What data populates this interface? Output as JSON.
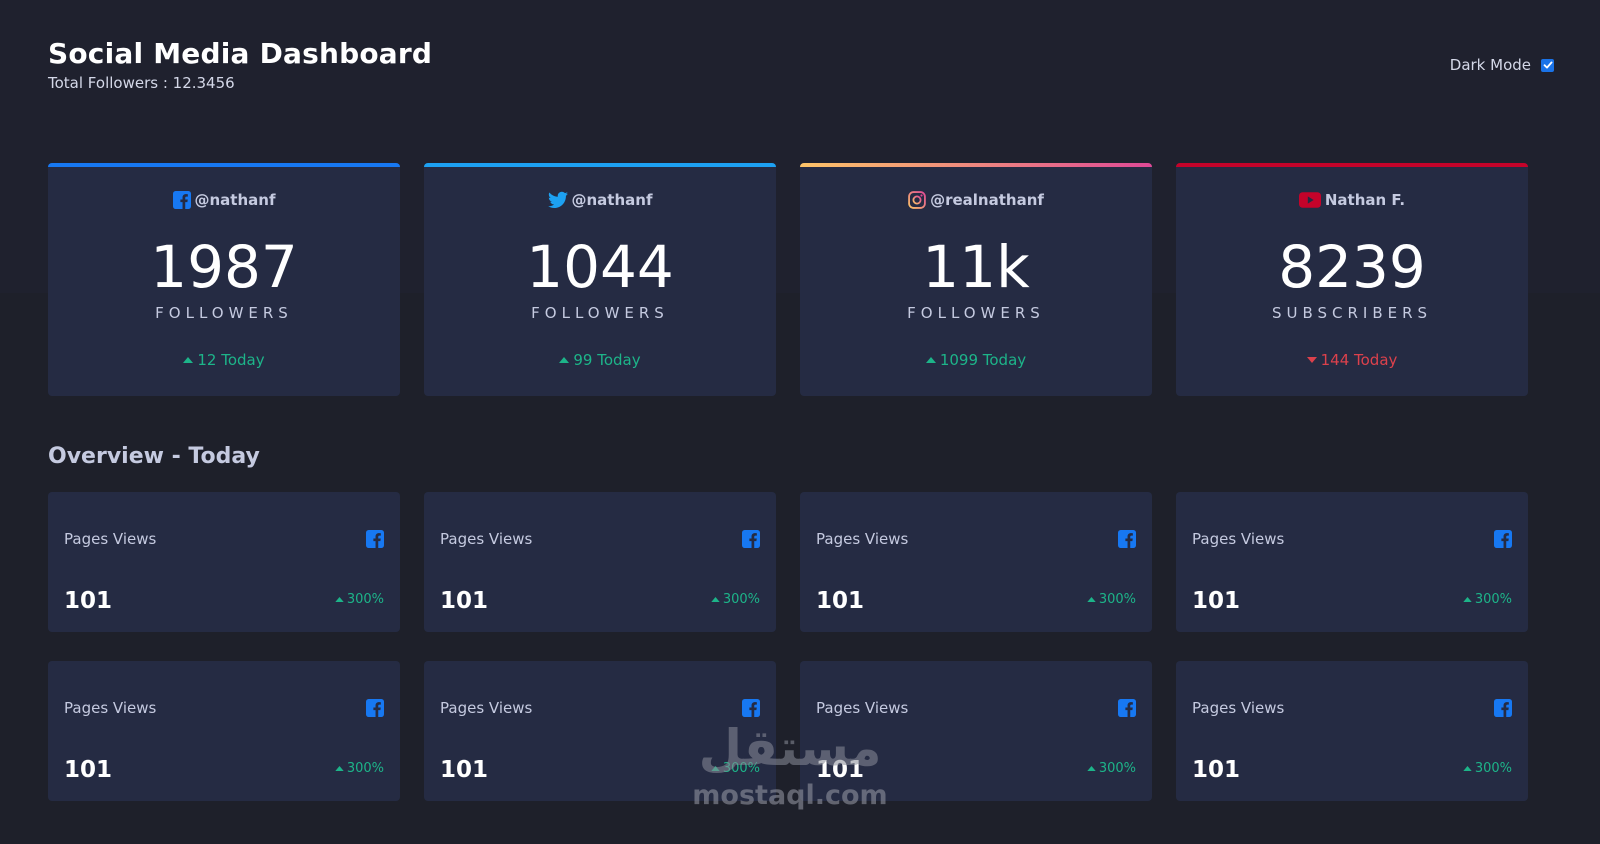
{
  "header": {
    "title": "Social Media Dashboard",
    "total_followers": "Total Followers : 12.3456",
    "dark_mode_label": "Dark Mode",
    "dark_mode_checked": true
  },
  "colors": {
    "facebook": "#1778f2",
    "twitter": "#1da1f2",
    "instagram_gradient": [
      "#fdc468",
      "#df4996"
    ],
    "youtube": "#c4032a",
    "positive": "#1db489",
    "negative": "#dc414c"
  },
  "follower_cards": [
    {
      "platform": "facebook",
      "icon": "facebook-icon",
      "handle": "@nathanf",
      "count": "1987",
      "label": "FOLLOWERS",
      "change": "12 Today",
      "trend": "up"
    },
    {
      "platform": "twitter",
      "icon": "twitter-icon",
      "handle": "@nathanf",
      "count": "1044",
      "label": "FOLLOWERS",
      "change": "99 Today",
      "trend": "up"
    },
    {
      "platform": "instagram",
      "icon": "instagram-icon",
      "handle": "@realnathanf",
      "count": "11k",
      "label": "FOLLOWERS",
      "change": "1099 Today",
      "trend": "up"
    },
    {
      "platform": "youtube",
      "icon": "youtube-icon",
      "handle": "Nathan F.",
      "count": "8239",
      "label": "SUBSCRIBERS",
      "change": "144 Today",
      "trend": "down"
    }
  ],
  "overview": {
    "title": "Overview - Today",
    "cards": [
      {
        "label": "Pages Views",
        "icon": "facebook-icon",
        "value": "101",
        "change": "300%",
        "trend": "up"
      },
      {
        "label": "Pages Views",
        "icon": "facebook-icon",
        "value": "101",
        "change": "300%",
        "trend": "up"
      },
      {
        "label": "Pages Views",
        "icon": "facebook-icon",
        "value": "101",
        "change": "300%",
        "trend": "up"
      },
      {
        "label": "Pages Views",
        "icon": "facebook-icon",
        "value": "101",
        "change": "300%",
        "trend": "up"
      },
      {
        "label": "Pages Views",
        "icon": "facebook-icon",
        "value": "101",
        "change": "300%",
        "trend": "up"
      },
      {
        "label": "Pages Views",
        "icon": "facebook-icon",
        "value": "101",
        "change": "300%",
        "trend": "up"
      },
      {
        "label": "Pages Views",
        "icon": "facebook-icon",
        "value": "101",
        "change": "300%",
        "trend": "up"
      },
      {
        "label": "Pages Views",
        "icon": "facebook-icon",
        "value": "101",
        "change": "300%",
        "trend": "up"
      }
    ]
  },
  "watermark": {
    "arabic": "مستقل",
    "latin": "mostaql.com"
  }
}
